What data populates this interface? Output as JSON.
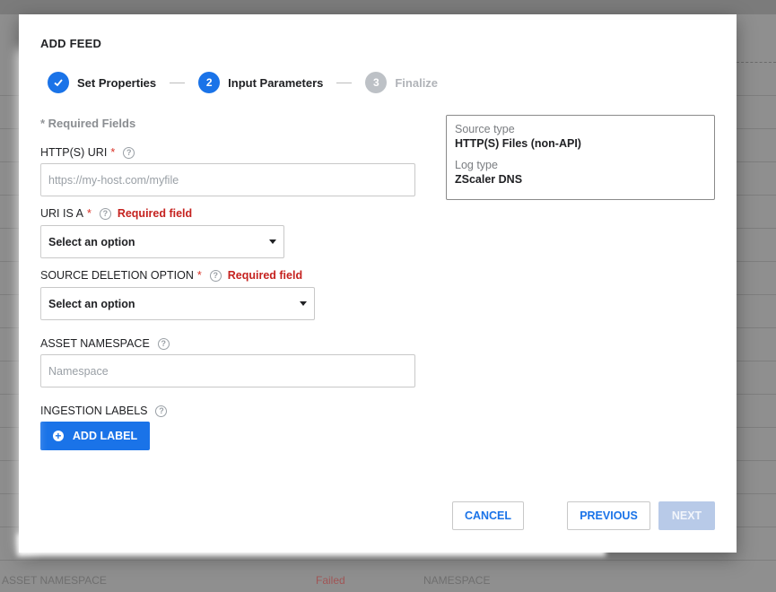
{
  "background": {
    "bottom_row_text_left": "ASSET NAMESPACE",
    "bottom_row_text_mid": "Failed",
    "bottom_row_text_right": "NAMESPACE"
  },
  "modal": {
    "title": "ADD FEED",
    "steps": [
      {
        "number": "✓",
        "label": "Set Properties",
        "state": "done"
      },
      {
        "number": "2",
        "label": "Input Parameters",
        "state": "active"
      },
      {
        "number": "3",
        "label": "Finalize",
        "state": "pending"
      }
    ],
    "required_note": "* Required Fields",
    "fields": {
      "uri": {
        "label": "HTTP(S) URI",
        "required": "*",
        "placeholder": "https://my-host.com/myfile",
        "value": ""
      },
      "uri_is_a": {
        "label": "URI IS A",
        "required": "*",
        "error": "Required field",
        "selected": "Select an option"
      },
      "source_deletion": {
        "label": "SOURCE DELETION OPTION",
        "required": "*",
        "error": "Required field",
        "selected": "Select an option"
      },
      "asset_namespace": {
        "label": "ASSET NAMESPACE",
        "placeholder": "Namespace",
        "value": ""
      },
      "ingestion_labels": {
        "label": "INGESTION LABELS",
        "button": "ADD LABEL"
      }
    },
    "info": {
      "source_type_label": "Source type",
      "source_type_value": "HTTP(S) Files (non-API)",
      "log_type_label": "Log type",
      "log_type_value": "ZScaler DNS"
    },
    "buttons": {
      "cancel": "CANCEL",
      "previous": "PREVIOUS",
      "next": "NEXT"
    },
    "colors": {
      "accent": "#1a73e8",
      "error": "#c5221f",
      "disabled": "#b8cae8"
    }
  }
}
